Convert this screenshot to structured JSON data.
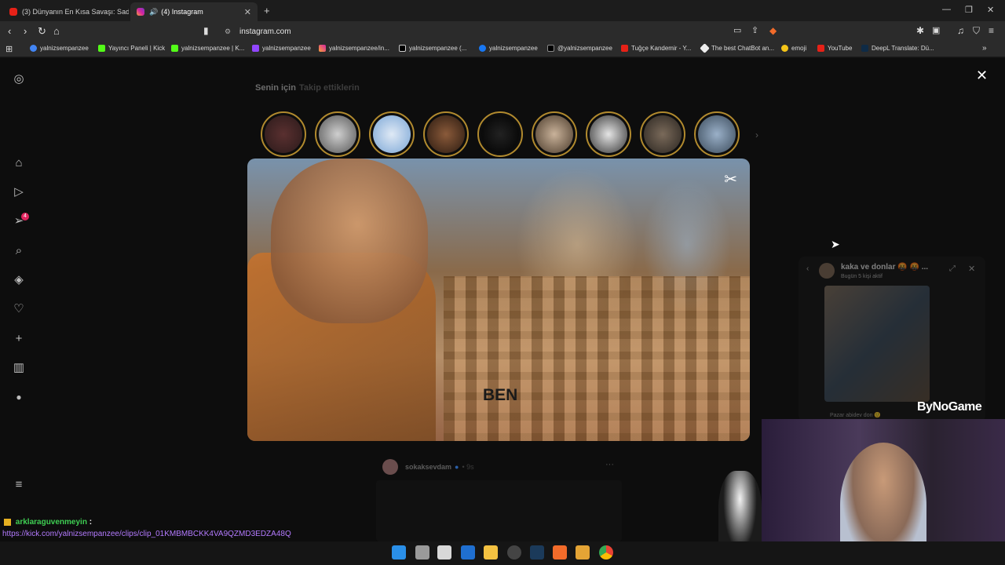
{
  "tabs": [
    {
      "title": "(3) Dünyanın En Kısa Savaşı: Sadece"
    },
    {
      "title": "(4) Instagram"
    }
  ],
  "toolbar": {
    "url": "instagram.com"
  },
  "bookmarks": [
    "yalnizsempanzee",
    "Yayıncı Paneli | Kick",
    "yalnizsempanzee | K...",
    "yalnizsempanzee",
    "yalnizsempanzee/in...",
    "yalnizsempanzee (...",
    "yalnizsempanzee",
    "@yalnizsempanzee",
    "Tuğçe Kandemir - Y...",
    "The best ChatBot an...",
    "emoji",
    "YouTube",
    "DeepL Translate: Dü..."
  ],
  "feed": {
    "tab_for_you": "Senin için",
    "tab_following": "Takip ettiklerin"
  },
  "video": {
    "caption": "BEN"
  },
  "post": {
    "username": "sokaksevdam",
    "time": "• 9s"
  },
  "chat": {
    "title": "kaka ve donlar 🤬 🤬 ...",
    "subtitle": "Bugün 5 kişi aktif",
    "footer": "Pazar abidev don 🙂"
  },
  "stream": {
    "brand": "ByNoGame",
    "chat_user": "arklaraguvenmeyin",
    "chat_colon": ":",
    "chat_link": "https://kick.com/yalnizsempanzee/clips/clip_01KMBMBCKK4VA9QZMD3EDZA48Q"
  },
  "notifications": {
    "messages_badge": "4"
  }
}
